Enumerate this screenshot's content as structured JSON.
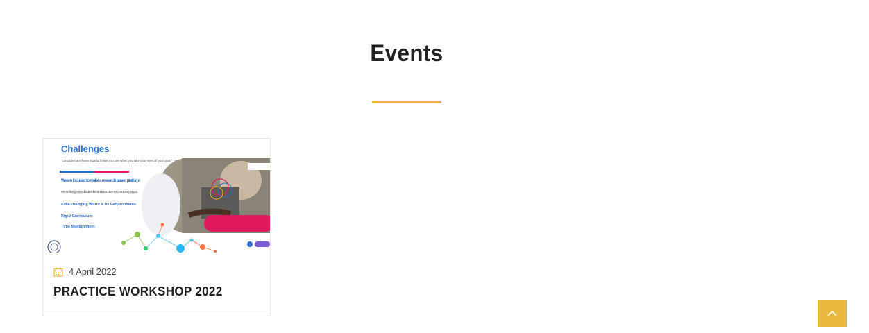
{
  "section": {
    "title": "Events"
  },
  "events": [
    {
      "date": "4 April 2022",
      "title": "PRACTICE WORKSHOP 2022",
      "thumbnail": {
        "heading": "Challenges",
        "quote": "\"Obstacles are those frightful things you see when you take your eyes off your goal.\" - Henry Ford",
        "focus": "We are focused to make a research based platform",
        "focus_sub": "We are facing many difficulties like as infrastructure and mentoring support",
        "item1": "Ever-changing World & Its Requirements",
        "item2": "Rigid Curriculum",
        "item3": "Time Management"
      }
    }
  ],
  "colors": {
    "accent": "#e8b73d",
    "heading_blue": "#2a6fc9",
    "pink": "#e0195e"
  },
  "icons": {
    "date": "calendar-icon",
    "back_to_top": "chevron-up-icon"
  }
}
